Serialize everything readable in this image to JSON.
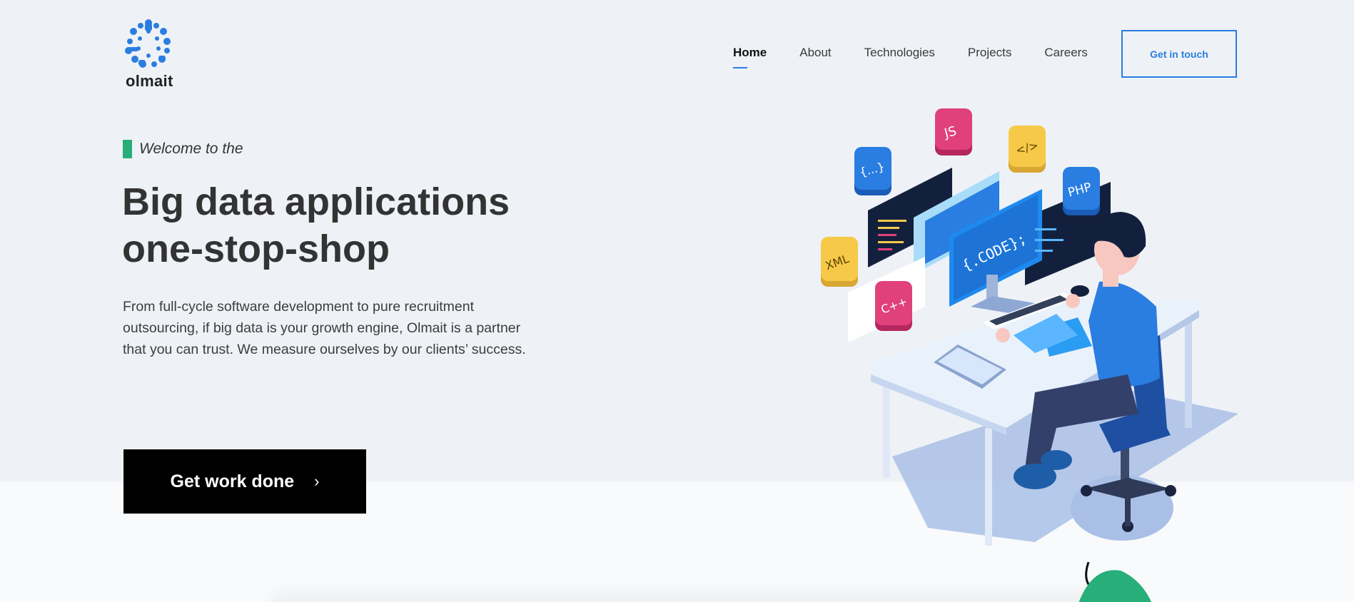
{
  "brand": {
    "name": "olmait",
    "accent": "#2a7de1",
    "green": "#27ae79"
  },
  "nav": {
    "items": [
      {
        "label": "Home",
        "active": true
      },
      {
        "label": "About"
      },
      {
        "label": "Technologies"
      },
      {
        "label": "Projects"
      },
      {
        "label": "Careers"
      }
    ],
    "cta": "Get in touch"
  },
  "hero": {
    "eyebrow": "Welcome to the",
    "headline_line1": "Big data applications",
    "headline_line2": "one-stop-shop",
    "description": "From full-cycle software development to pure recruitment outsourcing, if big data is your growth engine, Olmait is a partner that you can trust. We measure ourselves by our clients’ success.",
    "button_label": "Get work done",
    "button_icon": "chevron-right-icon"
  },
  "illustration": {
    "tiles": [
      "JS",
      "</>",
      "{...}",
      "PHP",
      "XML",
      "C++",
      "{.CODE};"
    ]
  }
}
